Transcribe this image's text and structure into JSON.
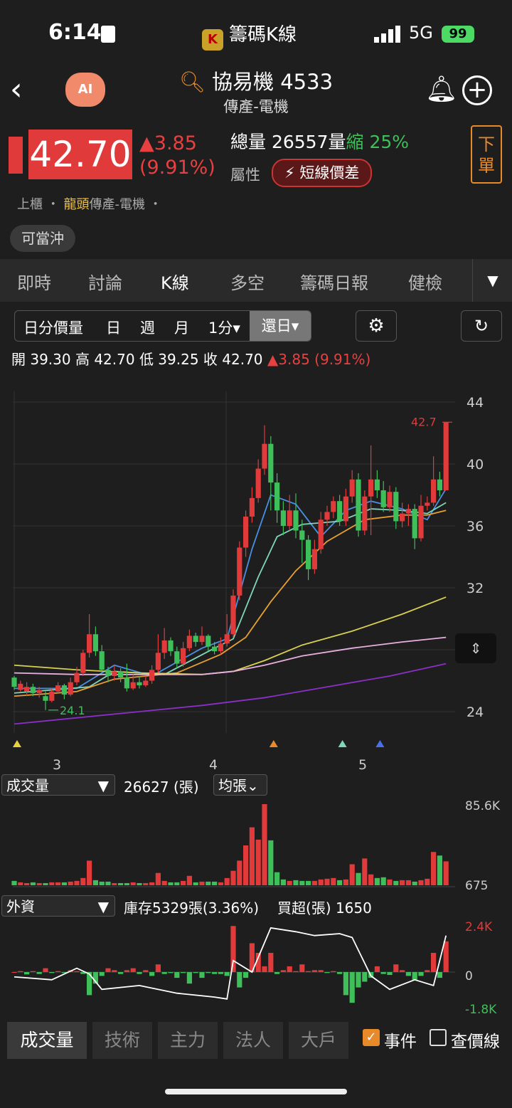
{
  "status_bar": {
    "time": "6:14",
    "app": "籌碼K線",
    "app_logo_text": "K",
    "network": "5G",
    "battery": "99"
  },
  "header": {
    "title": "協易機 4533",
    "subtitle": "傳產-電機",
    "ai_label": "AI"
  },
  "quote": {
    "price": "42.70",
    "change": "▲3.85",
    "change_pct": "(9.91%)",
    "volume_label": "總量",
    "volume": "26557",
    "volume_unit": "量",
    "shrink_label": "縮",
    "shrink_pct": "25%",
    "attr_label": "屬性",
    "attr_tag": "⚡ 短線價差",
    "order_button": "下單",
    "market": "上櫃",
    "leader": "龍頭",
    "industry": "傳產-電機",
    "daytrade": "可當沖"
  },
  "tabs": [
    "即時",
    "討論",
    "K線",
    "多空",
    "籌碼日報",
    "健檢"
  ],
  "active_tab": "K線",
  "chart_toolbar": {
    "items": [
      "日分價量",
      "日",
      "週",
      "月",
      "1分▾"
    ],
    "selected": "還日▾"
  },
  "ohlc": {
    "text": "開 39.30  高 42.70  低 39.25  收 42.70",
    "change": "▲3.85 (9.91%)"
  },
  "colors": {
    "up": "#e03a3a",
    "down": "#3fbf5a",
    "ma5": "#4a90e2",
    "ma10": "#7fd6b8",
    "ma20": "#e8a030",
    "ma60": "#d8d050",
    "ma120": "#e8b0e0",
    "ma240": "#8a30c8",
    "accent": "#e8892a"
  },
  "chart_data": [
    {
      "type": "candlestick",
      "y_ticks": [
        "44",
        "40",
        "36",
        "32",
        "24"
      ],
      "y_tick_values": [
        44,
        40,
        36,
        32,
        24
      ],
      "ylim": [
        22,
        45
      ],
      "x_ticks": [
        "3",
        "4",
        "5"
      ],
      "last_price_label": "42.7",
      "low_label": "24.1",
      "candles": [
        [
          26.2,
          25.6,
          26.3,
          25.4
        ],
        [
          25.4,
          25.8,
          26.0,
          25.3
        ],
        [
          25.3,
          25.6,
          25.9,
          25.0
        ],
        [
          25.6,
          25.2,
          25.8,
          25.0
        ],
        [
          25.2,
          25.4,
          25.6,
          24.9
        ],
        [
          25.0,
          24.7,
          25.3,
          24.1
        ],
        [
          24.7,
          25.3,
          25.5,
          24.6
        ],
        [
          25.3,
          25.7,
          25.9,
          25.2
        ],
        [
          25.7,
          25.1,
          25.8,
          24.8
        ],
        [
          25.1,
          25.9,
          26.2,
          25.0
        ],
        [
          25.9,
          26.5,
          26.9,
          25.7
        ],
        [
          26.5,
          27.8,
          28.0,
          26.3
        ],
        [
          27.8,
          29.0,
          30.3,
          27.5
        ],
        [
          29.0,
          27.9,
          29.5,
          27.6
        ],
        [
          27.9,
          26.7,
          28.3,
          26.4
        ],
        [
          26.7,
          26.3,
          26.9,
          25.9
        ],
        [
          26.3,
          26.6,
          27.0,
          26.0
        ],
        [
          26.6,
          26.2,
          26.8,
          25.9
        ],
        [
          26.2,
          25.5,
          27.1,
          25.3
        ],
        [
          25.5,
          25.9,
          26.4,
          25.4
        ],
        [
          25.9,
          25.7,
          26.3,
          25.5
        ],
        [
          25.7,
          26.0,
          26.3,
          25.6
        ],
        [
          26.0,
          26.7,
          27.0,
          25.8
        ],
        [
          26.7,
          27.8,
          29.0,
          26.5
        ],
        [
          27.8,
          28.6,
          29.4,
          27.4
        ],
        [
          28.6,
          27.9,
          28.8,
          27.6
        ],
        [
          27.9,
          27.1,
          28.2,
          26.8
        ],
        [
          27.1,
          28.1,
          28.5,
          26.9
        ],
        [
          28.1,
          28.9,
          29.3,
          27.9
        ],
        [
          28.9,
          28.5,
          29.1,
          28.2
        ],
        [
          28.5,
          28.9,
          29.5,
          28.3
        ],
        [
          28.9,
          28.2,
          29.0,
          27.9
        ],
        [
          28.2,
          27.9,
          28.5,
          27.7
        ],
        [
          27.9,
          28.4,
          28.8,
          27.7
        ],
        [
          28.4,
          29.0,
          30.3,
          28.2
        ],
        [
          29.0,
          31.5,
          31.9,
          28.8
        ],
        [
          31.5,
          34.6,
          35.0,
          31.2
        ],
        [
          34.6,
          36.6,
          37.0,
          34.0
        ],
        [
          36.6,
          37.8,
          38.5,
          36.2
        ],
        [
          37.8,
          39.7,
          40.3,
          37.5
        ],
        [
          39.7,
          41.3,
          42.5,
          39.3
        ],
        [
          41.3,
          38.8,
          41.8,
          37.0
        ],
        [
          38.8,
          37.0,
          39.4,
          36.2
        ],
        [
          37.0,
          36.0,
          37.6,
          35.4
        ],
        [
          36.0,
          37.0,
          38.0,
          35.7
        ],
        [
          37.0,
          35.7,
          38.1,
          35.2
        ],
        [
          35.7,
          35.1,
          36.4,
          33.6
        ],
        [
          35.1,
          33.2,
          35.4,
          32.5
        ],
        [
          33.2,
          34.5,
          35.1,
          32.9
        ],
        [
          34.5,
          36.4,
          36.9,
          34.2
        ],
        [
          36.4,
          36.9,
          37.3,
          36.0
        ],
        [
          36.9,
          37.6,
          37.9,
          36.5
        ],
        [
          37.6,
          36.3,
          38.0,
          36.0
        ],
        [
          36.3,
          37.9,
          38.4,
          36.0
        ],
        [
          37.9,
          39.0,
          39.6,
          37.5
        ],
        [
          39.0,
          35.7,
          39.4,
          35.3
        ],
        [
          35.7,
          37.9,
          38.3,
          35.4
        ],
        [
          37.9,
          39.0,
          41.2,
          35.4
        ],
        [
          39.0,
          38.3,
          39.6,
          37.8
        ],
        [
          38.3,
          37.2,
          38.9,
          36.9
        ],
        [
          37.2,
          38.2,
          38.6,
          36.9
        ],
        [
          38.2,
          36.3,
          38.5,
          35.8
        ],
        [
          36.3,
          36.8,
          37.5,
          35.9
        ],
        [
          36.8,
          37.1,
          37.4,
          36.0
        ],
        [
          37.1,
          35.2,
          37.4,
          34.5
        ],
        [
          35.2,
          37.3,
          38.0,
          35.0
        ],
        [
          37.3,
          37.5,
          37.9,
          37.0
        ],
        [
          37.5,
          39.0,
          40.5,
          37.3
        ],
        [
          39.0,
          38.3,
          39.5,
          37.9
        ],
        [
          38.3,
          42.7,
          42.7,
          38.3
        ]
      ],
      "ma": {
        "ma5": [
          [
            0,
            25.5
          ],
          [
            10,
            25.5
          ],
          [
            16,
            27.0
          ],
          [
            22,
            26.3
          ],
          [
            30,
            28.1
          ],
          [
            34,
            28.7
          ],
          [
            38,
            34.5
          ],
          [
            41,
            38.0
          ],
          [
            45,
            37.4
          ],
          [
            49,
            35.3
          ],
          [
            53,
            37.0
          ],
          [
            57,
            37.6
          ],
          [
            62,
            37.1
          ],
          [
            66,
            36.4
          ],
          [
            69,
            38.4
          ]
        ],
        "ma10": [
          [
            0,
            25.2
          ],
          [
            12,
            25.6
          ],
          [
            16,
            26.6
          ],
          [
            24,
            26.4
          ],
          [
            32,
            28.1
          ],
          [
            35,
            28.7
          ],
          [
            39,
            32.7
          ],
          [
            42,
            35.3
          ],
          [
            46,
            36.1
          ],
          [
            52,
            36.3
          ],
          [
            57,
            37.1
          ],
          [
            62,
            37.0
          ],
          [
            66,
            36.8
          ],
          [
            69,
            37.5
          ]
        ],
        "ma20": [
          [
            0,
            25.0
          ],
          [
            10,
            25.3
          ],
          [
            16,
            26.1
          ],
          [
            26,
            26.5
          ],
          [
            33,
            27.7
          ],
          [
            37,
            28.8
          ],
          [
            41,
            31.1
          ],
          [
            45,
            33.1
          ],
          [
            50,
            35.0
          ],
          [
            56,
            36.4
          ],
          [
            62,
            36.7
          ],
          [
            66,
            36.7
          ],
          [
            69,
            37.0
          ]
        ],
        "ma60": [
          [
            0,
            27.0
          ],
          [
            10,
            26.7
          ],
          [
            20,
            26.5
          ],
          [
            30,
            26.4
          ],
          [
            35,
            26.6
          ],
          [
            40,
            27.3
          ],
          [
            46,
            28.3
          ],
          [
            54,
            29.2
          ],
          [
            62,
            30.3
          ],
          [
            69,
            31.4
          ]
        ],
        "ma120": [
          [
            0,
            26.5
          ],
          [
            10,
            26.4
          ],
          [
            20,
            26.4
          ],
          [
            30,
            26.4
          ],
          [
            35,
            26.6
          ],
          [
            40,
            27.0
          ],
          [
            46,
            27.6
          ],
          [
            54,
            28.1
          ],
          [
            62,
            28.5
          ],
          [
            69,
            28.8
          ]
        ],
        "ma240": [
          [
            0,
            23.2
          ],
          [
            10,
            23.6
          ],
          [
            20,
            24.0
          ],
          [
            30,
            24.4
          ],
          [
            40,
            24.9
          ],
          [
            50,
            25.6
          ],
          [
            60,
            26.3
          ],
          [
            69,
            27.1
          ]
        ]
      },
      "event_markers": [
        {
          "index": 0,
          "color": "#e8d040"
        },
        {
          "index": 41,
          "color": "#e8892a"
        },
        {
          "index": 52,
          "color": "#7fd6b8"
        },
        {
          "index": 58,
          "color": "#4a70e8"
        }
      ]
    },
    {
      "type": "bar",
      "name": "成交量",
      "y_ticks": [
        "85.6K",
        "675"
      ],
      "volumes": [
        6,
        4,
        3,
        4,
        3,
        3,
        4,
        4,
        4,
        5,
        6,
        10,
        34,
        7,
        5,
        5,
        3,
        3,
        3,
        4,
        3,
        3,
        4,
        17,
        6,
        4,
        4,
        6,
        13,
        4,
        5,
        5,
        5,
        4,
        10,
        20,
        34,
        55,
        80,
        63,
        112,
        62,
        18,
        8,
        6,
        7,
        6,
        6,
        6,
        8,
        9,
        10,
        7,
        8,
        29,
        17,
        37,
        15,
        10,
        11,
        8,
        6,
        7,
        7,
        5,
        7,
        9,
        46,
        41,
        33
      ]
    },
    {
      "type": "bar",
      "name": "外資",
      "y_ticks": [
        "2.4K",
        "0",
        "-1.8K"
      ],
      "net": [
        0,
        0.05,
        -0.12,
        0.05,
        -0.1,
        0.2,
        -0.05,
        0.05,
        -0.05,
        0.1,
        0.05,
        -0.1,
        -1.2,
        -0.6,
        -0.2,
        0.2,
        0.1,
        -0.1,
        0.1,
        0.2,
        -0.1,
        0.1,
        -0.2,
        0.4,
        -0.1,
        -0.05,
        -0.3,
        -0.05,
        -0.6,
        -0.05,
        -0.3,
        -0.05,
        -0.1,
        -0.1,
        -0.2,
        2.4,
        -0.8,
        -0.3,
        1.5,
        1.0,
        0.3,
        1.0,
        -0.1,
        0.1,
        0.3,
        0.05,
        0.4,
        0.05,
        0.1,
        0.1,
        -0.05,
        0.05,
        -0.1,
        -1.2,
        -1.6,
        -0.8,
        -0.5,
        -0.3,
        0.3,
        -0.1,
        -0.15,
        0.4,
        0.1,
        -0.2,
        -0.4,
        -0.2,
        0.1,
        1.0,
        -0.3,
        1.6
      ],
      "cumulative_line": [
        [
          0,
          -0.25
        ],
        [
          6,
          -0.4
        ],
        [
          10,
          0.2
        ],
        [
          12,
          -0.1
        ],
        [
          14,
          -0.9
        ],
        [
          20,
          -0.7
        ],
        [
          26,
          -1.1
        ],
        [
          32,
          -1.3
        ],
        [
          34,
          -1.4
        ],
        [
          35,
          0.6
        ],
        [
          38,
          0.0
        ],
        [
          41,
          2.3
        ],
        [
          45,
          2.1
        ],
        [
          48,
          1.9
        ],
        [
          52,
          2.0
        ],
        [
          54,
          1.8
        ],
        [
          57,
          -0.2
        ],
        [
          60,
          -0.9
        ],
        [
          64,
          -0.4
        ],
        [
          67,
          -0.7
        ],
        [
          69,
          1.9
        ]
      ]
    }
  ],
  "volume_panel": {
    "selector": "成交量",
    "value": "26627 (張)",
    "avg_button": "均張⌄"
  },
  "foreign_panel": {
    "selector": "外資",
    "inventory": "庫存5329張(3.36%)",
    "net_buy": "買超(張) 1650"
  },
  "bottom_tabs": [
    "成交量",
    "技術",
    "主力",
    "法人",
    "大戶"
  ],
  "bottom_active": "成交量",
  "checkboxes": [
    {
      "label": "事件",
      "checked": true
    },
    {
      "label": "查價線",
      "checked": false
    }
  ]
}
